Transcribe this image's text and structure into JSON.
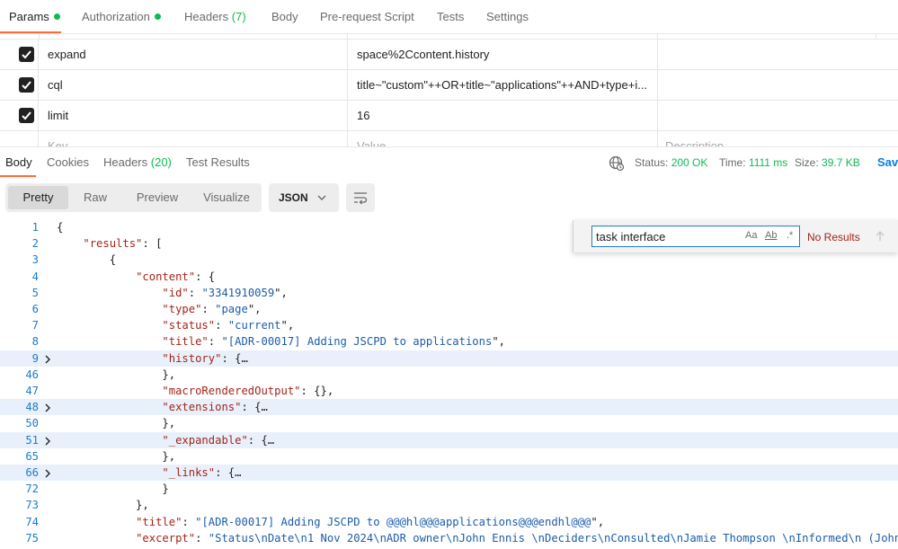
{
  "request_tabs": [
    {
      "label": "Params",
      "dot": true
    },
    {
      "label": "Authorization",
      "dot": true
    },
    {
      "label": "Headers",
      "count": "(7)"
    },
    {
      "label": "Body"
    },
    {
      "label": "Pre-request Script"
    },
    {
      "label": "Tests"
    },
    {
      "label": "Settings"
    }
  ],
  "params": [
    {
      "key": "expand",
      "value": "space%2Ccontent.history",
      "checked": true
    },
    {
      "key": "cql",
      "value": "title~\"custom\"++OR+title~\"applications\"++AND+type+i...",
      "checked": true
    },
    {
      "key": "limit",
      "value": "16",
      "checked": true
    }
  ],
  "params_placeholder": {
    "key": "Key",
    "value": "Value",
    "description": "Description"
  },
  "response_tabs": [
    {
      "label": "Body"
    },
    {
      "label": "Cookies"
    },
    {
      "label": "Headers",
      "count": "(20)"
    },
    {
      "label": "Test Results"
    }
  ],
  "response_status": {
    "status_label": "Status:",
    "status_value": "200 OK",
    "time_label": "Time:",
    "time_value": "1111 ms",
    "size_label": "Size:",
    "size_value": "39.7 KB",
    "save_label": "Sav"
  },
  "view_modes": [
    "Pretty",
    "Raw",
    "Preview",
    "Visualize"
  ],
  "format": {
    "selected": "JSON"
  },
  "find": {
    "query": "task interface",
    "match_case": "Aa",
    "whole_word": "Ab",
    "regex": ".*",
    "result": "No Results"
  },
  "code_lines": [
    {
      "n": "1",
      "text": "{"
    },
    {
      "n": "2",
      "text": "    \"results\": ["
    },
    {
      "n": "3",
      "text": "        {"
    },
    {
      "n": "4",
      "text": "            \"content\": {"
    },
    {
      "n": "5",
      "text": "                \"id\": \"3341910059\","
    },
    {
      "n": "6",
      "text": "                \"type\": \"page\","
    },
    {
      "n": "7",
      "text": "                \"status\": \"current\","
    },
    {
      "n": "8",
      "text": "                \"title\": \"[ADR-00017] Adding JSCPD to applications\","
    },
    {
      "n": "9",
      "text": "                \"history\": {…",
      "folded": true
    },
    {
      "n": "46",
      "text": "                },"
    },
    {
      "n": "47",
      "text": "                \"macroRenderedOutput\": {},"
    },
    {
      "n": "48",
      "text": "                \"extensions\": {…",
      "folded": true
    },
    {
      "n": "50",
      "text": "                },"
    },
    {
      "n": "51",
      "text": "                \"_expandable\": {…",
      "folded": true
    },
    {
      "n": "65",
      "text": "                },"
    },
    {
      "n": "66",
      "text": "                \"_links\": {…",
      "folded": true
    },
    {
      "n": "72",
      "text": "                }"
    },
    {
      "n": "73",
      "text": "            },"
    },
    {
      "n": "74",
      "text": "            \"title\": \"[ADR-00017] Adding JSCPD to @@@hl@@@applications@@@endhl@@@\","
    },
    {
      "n": "75",
      "text": "            \"excerpt\": \"Status\\nDate\\n1 Nov 2024\\nADR owner\\nJohn Ennis \\nDeciders\\nConsulted\\nJamie Thompson \\nInformed\\n (John"
    }
  ]
}
